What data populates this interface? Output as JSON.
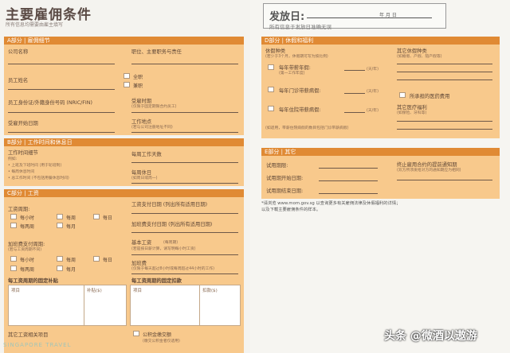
{
  "left_page": {
    "title": "主要雇佣条件",
    "subtitle": "所有信息均需要由雇主填写",
    "section_a": {
      "header": "A部分 | 雇佣细节",
      "company_name": "公司名称",
      "job_title": "职位、主要职务与责任",
      "employee_name": "员工姓名",
      "full_time": "全职",
      "part_time": "兼职",
      "id_number": "员工身份证/外籍身份号码 (NRIC/FIN)",
      "employment_period": "受雇时期",
      "employment_period_note": "(仅限于固定期限合约员工)",
      "start_date": "受雇开始日期",
      "work_place": "工作地点",
      "work_place_note": "(若与公司注册地址不同)"
    },
    "section_b": {
      "header": "B部分 | 工作时间和休息日",
      "work_arrangement": "工作时间细节",
      "work_arrangement_note1": "例如:",
      "work_arrangement_note2": "• 上班及下班时间 (用于轮班制)",
      "work_arrangement_note3": "• 每周休息时间",
      "work_arrangement_note4": "• 总工作时间 (不包括用餐休息时间)",
      "days_per_week": "每周工作天数",
      "rest_day": "每周休日",
      "rest_day_note": "(如周日或周一)"
    },
    "section_c": {
      "header": "C部分 | 工资",
      "salary_period": "工资周期:",
      "hourly": "每小时",
      "daily": "每日",
      "weekly": "每周",
      "fortnightly": "每两周",
      "monthly": "每月",
      "salary_payment_date": "工资支付日期 (列出所有适用日期)",
      "overtime_payment_date": "加班费支付日期 (列出所有适用日期)",
      "overtime_period": "加班费支付周期:",
      "overtime_period_note": "(若与工资周期不同)",
      "ot_hourly": "每小时",
      "ot_daily": "每日",
      "ot_weekly": "每周",
      "ot_fortnightly": "每两周",
      "ot_monthly": "每月",
      "basic_salary": "基本工资",
      "basic_salary_note": "(每周期)",
      "basic_salary_note2": "(若是按日薪计算，请写明每小时工资)",
      "overtime_rate": "加班费",
      "overtime_rate_note": "(仅限于每天超过8小时或每周超过44小时的工作)",
      "fixed_allowances": "每工资周期的固定补贴",
      "fixed_deductions": "每工资周期的固定扣款",
      "col_item": "项目",
      "col_allowance_amount": "补贴($)",
      "col_deduction_amount": "扣款($)",
      "other_salary": "其它工资相关项目",
      "cpf": "公积金缴交额",
      "cpf_note": "(缴交公积金者仅适用)"
    }
  },
  "right_page": {
    "issue_date_label": "发放日:",
    "issue_date_format": "年 月 日",
    "issue_note": "所有信息于发放日准确无误",
    "section_d": {
      "header": "D部分 | 休假和福利",
      "leave_types": "休假种类",
      "leave_types_note": "(若少于3个月，休假期可写为按比例)",
      "annual_leave": "每年带薪年假:",
      "annual_leave_note": "(第一工作年度)",
      "unit_days_1": "(天/年)",
      "outpatient_leave": "每年门诊带薪病假:",
      "unit_days_2": "(天/年)",
      "hospital_leave": "每年住院带薪病假:",
      "unit_days_3": "(天/年)",
      "leave_footnote": "(如适用，带薪住院病假的数目包括门诊带薪病假)",
      "other_leave": "其它休假种类",
      "other_leave_note": "(如婚假、产假、陪产假等)",
      "medical_benefits": "所承担的医药费用",
      "other_benefits": "其它医疗福利",
      "other_benefits_note": "(如保险、牙科等)"
    },
    "section_e": {
      "header": "E部分 | 其它",
      "probation_period": "试用期限:",
      "probation_start": "试用期开始日期:",
      "probation_end": "试用期结束日期:",
      "notice_period": "终止雇用合约的提前通知期",
      "notice_period_note": "(双方所须发给对方的通知期应为相同)"
    },
    "footnote_line1": "*请浏览 www.mom.gov.sg 以查询更多有关雇佣法律及休假福利的详情；",
    "footnote_line2": "以及下载主要雇佣条件的样本。"
  },
  "watermark_left": "SINGAPORE TRAVEL",
  "watermark_right": "头条 @微酒以遨游",
  "colors": {
    "section_header": "#e08a34",
    "section_body": "#f8c98c",
    "page_background": "#f4f3ef"
  }
}
